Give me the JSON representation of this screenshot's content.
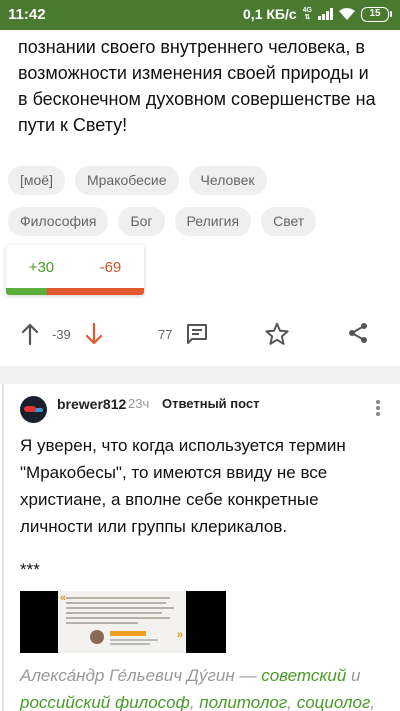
{
  "status_bar": {
    "time": "11:42",
    "speed": "0,1 КБ/с",
    "network_top": "4G",
    "network_bottom": "⇅",
    "battery": "15"
  },
  "post": {
    "text_lines": [
      "познании своего внутреннего человека, в",
      "возможности изменения своей природы и",
      "в бесконечном духовном совершенстве на",
      "пути к Свету!"
    ],
    "tags_row1": [
      "[моё]",
      "Мракобесие",
      "Человек"
    ],
    "tags_row2": [
      "Философия",
      "Бог",
      "Религия",
      "Свет"
    ],
    "rating": {
      "positive": "+30",
      "negative": "-69",
      "positive_fraction": 0.3
    },
    "actions": {
      "score": "-39",
      "comments_count": "77"
    }
  },
  "comment": {
    "author": "brewer812",
    "time": "23ч",
    "label": "Ответный пост",
    "text_lines": [
      "Я уверен, что когда используется термин",
      "\"Мракобесы\", то имеются ввиду не все",
      "христиане, а вполне себе конкретные",
      "личности или группы клерикалов."
    ],
    "separator": "***",
    "footer": {
      "name": "Алекса́ндр Ге́льевич Ду́гин",
      "dash": " — ",
      "link1": "советский",
      "and": " и",
      "link2": "российский философ",
      "comma1": ", ",
      "link3": "политолог",
      "comma2": ", ",
      "link4": "социолог",
      "comma3": ","
    }
  },
  "colors": {
    "status_bar": "#4a7a2f",
    "positive": "#5cae3a",
    "negative": "#e2572c",
    "link": "#4a9a2a"
  }
}
